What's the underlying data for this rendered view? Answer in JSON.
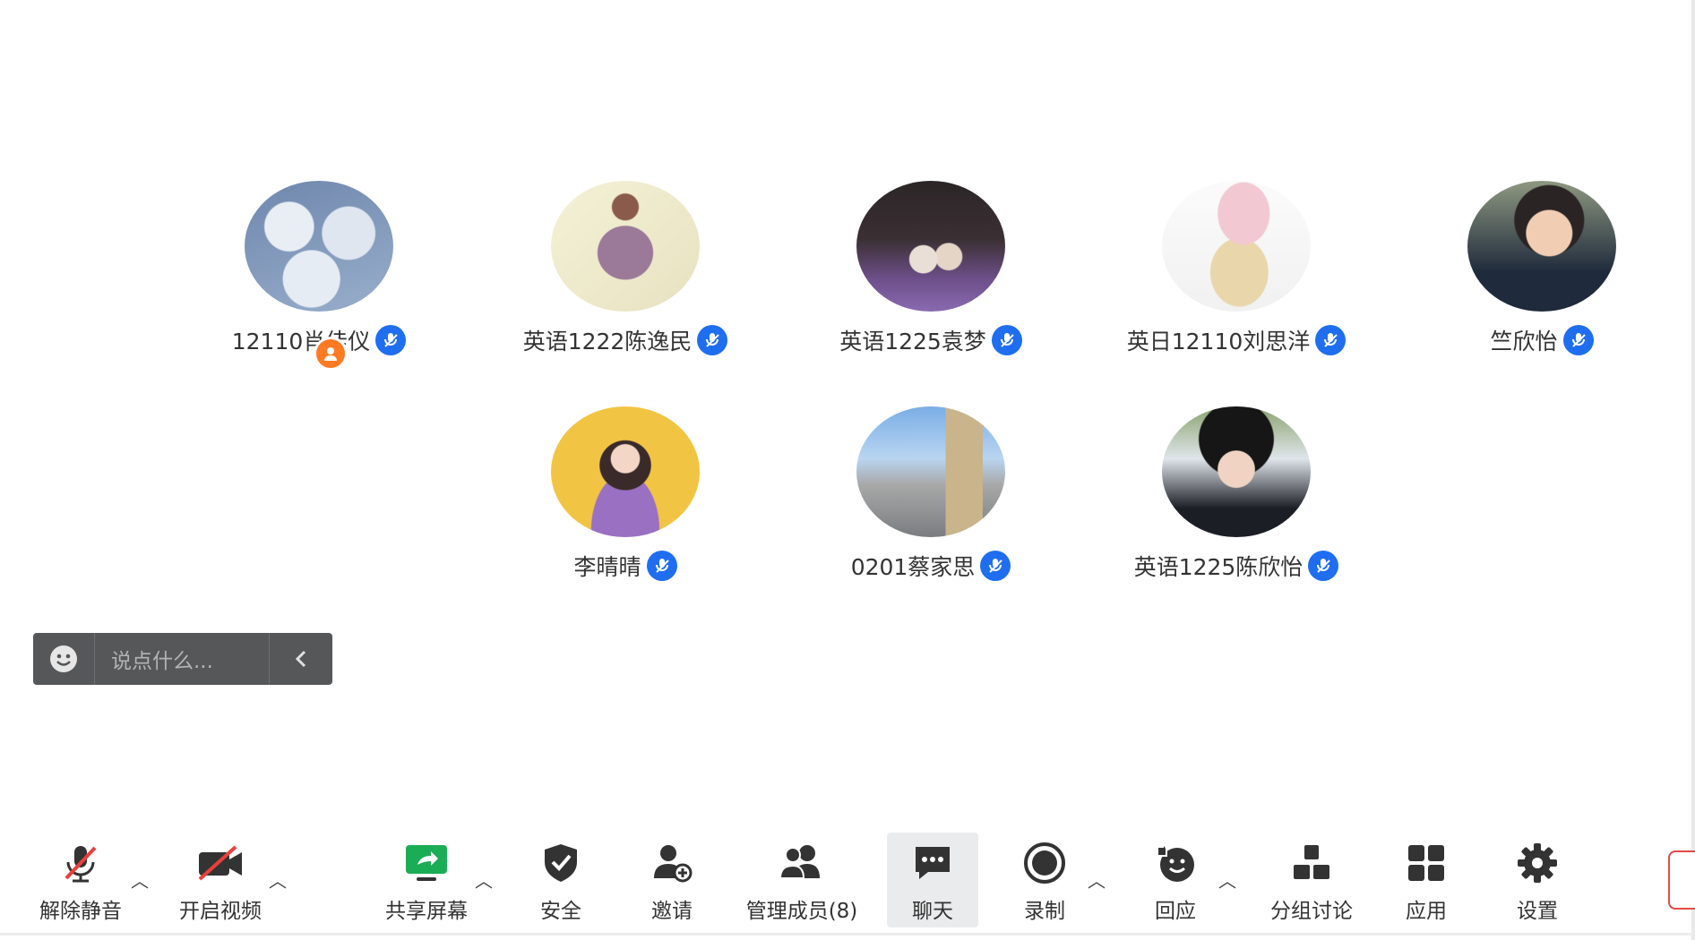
{
  "participants": [
    {
      "name": "12110肖佳仪",
      "host": true
    },
    {
      "name": "英语1222陈逸民",
      "host": false
    },
    {
      "name": "英语1225袁梦",
      "host": false
    },
    {
      "name": "英日12110刘思洋",
      "host": false
    },
    {
      "name": "竺欣怡",
      "host": false
    },
    {
      "name": "李晴晴",
      "host": false
    },
    {
      "name": "0201蔡家思",
      "host": false
    },
    {
      "name": "英语1225陈欣怡",
      "host": false
    }
  ],
  "chat": {
    "placeholder": "说点什么..."
  },
  "toolbar": {
    "unmute": "解除静音",
    "start_video": "开启视频",
    "share_screen": "共享屏幕",
    "security": "安全",
    "invite": "邀请",
    "manage_members": "管理成员(8)",
    "chat": "聊天",
    "record": "录制",
    "reaction": "回应",
    "breakout": "分组讨论",
    "apps": "应用",
    "settings": "设置"
  },
  "colors": {
    "mic_badge": "#1f6ef0",
    "host_badge": "#ff7a22",
    "share_green": "#1aad55",
    "muted_red": "#e8403c"
  }
}
